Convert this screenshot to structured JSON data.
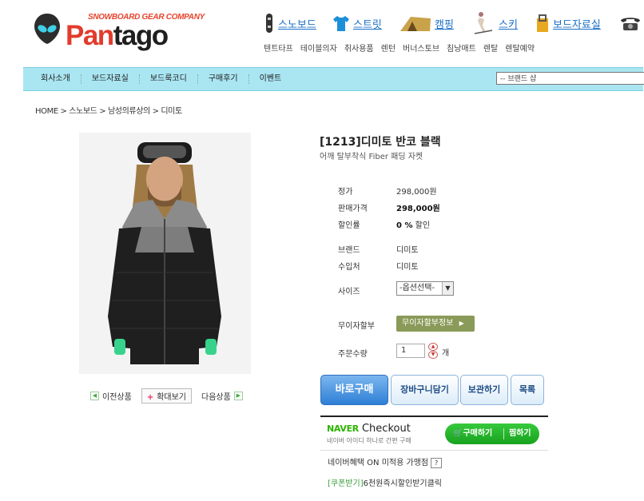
{
  "logo": {
    "tagline": "SNOWBOARD GEAR COMPANY",
    "name_part1": "Pan",
    "name_part2": "tago"
  },
  "topnav": {
    "categories": [
      {
        "label": "스노보드",
        "icon": "snowboard-icon"
      },
      {
        "label": "스트릿",
        "icon": "tshirt-icon"
      },
      {
        "label": "캠핑",
        "icon": "tent-icon"
      },
      {
        "label": "스키",
        "icon": "skier-icon"
      },
      {
        "label": "보드자료실",
        "icon": "clip-icon"
      }
    ],
    "phone_icon": "phone-icon",
    "sub_items": [
      "텐트타프",
      "테이블의자",
      "취사용품",
      "렌턴",
      "버너스토브",
      "침낭매트",
      "렌탈",
      "렌탈예약"
    ]
  },
  "menubar": {
    "items": [
      "회사소개",
      "보드자료실",
      "보드룩코디",
      "구매후기",
      "이벤트"
    ],
    "brand_select": "-- 브랜드 샵"
  },
  "breadcrumb": "HOME > 스노보드 > 남성의류상의 > 디미토",
  "image_nav": {
    "prev": "이전상품",
    "zoom": "확대보기",
    "next": "다음상품"
  },
  "product": {
    "title": "[1213]디미토 반코 블랙",
    "subtitle": "어깨 탈부착식 Fiber 패딩 자켓",
    "price_label": "정가",
    "price": "298,000원",
    "sale_label": "판매가격",
    "sale_price": "298,000원",
    "discount_label": "할인률",
    "discount": "0 %",
    "discount_suffix": "할인",
    "brand_label": "브랜드",
    "brand": "디미토",
    "importer_label": "수입처",
    "importer": "디미토",
    "size_label": "사이즈",
    "size_select": "-옵션선택-",
    "interest_label": "무이자할부",
    "interest_button": "무이자할부정보",
    "qty_label": "주문수량",
    "qty": "1",
    "qty_unit": "개"
  },
  "buttons": {
    "buy": "바로구매",
    "cart": "장바구니담기",
    "keep": "보관하기",
    "list": "목록"
  },
  "naver": {
    "brand": "NAVER",
    "checkout": "Checkout",
    "sub": "네이버 아이디 하나로 간편 구매",
    "buy": "구매하기",
    "wish": "찜하기",
    "benefit": "네이버혜택 ON 미적용 가맹점",
    "benefit_help": "?"
  },
  "coupon": {
    "tag": "[쿠폰받기]",
    "text": "6천원즉시할인받기클릭"
  },
  "colors": {
    "menubar_bg": "#a9e6f2",
    "buy_button": "#2f7fd6",
    "naver_green": "#18a21e",
    "link_blue": "#1a6fc7"
  }
}
